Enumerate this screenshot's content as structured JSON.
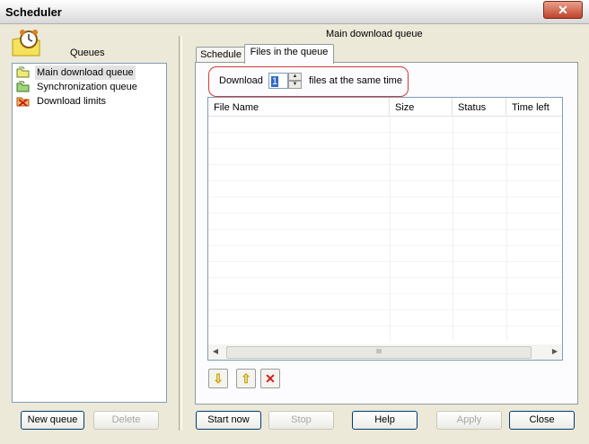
{
  "window": {
    "title": "Scheduler",
    "close_glyph": "✕"
  },
  "sidebar": {
    "heading": "Queues",
    "items": [
      {
        "label": "Main download queue",
        "icon": "queue-folder-icon",
        "selected": true
      },
      {
        "label": "Synchronization queue",
        "icon": "sync-queue-icon",
        "selected": false
      },
      {
        "label": "Download limits",
        "icon": "download-limits-icon",
        "selected": false
      }
    ],
    "new_queue_label": "New queue",
    "delete_label": "Delete"
  },
  "main": {
    "heading": "Main download queue",
    "tabs": [
      {
        "label": "Schedule",
        "active": false
      },
      {
        "label": "Files in the queue",
        "active": true
      }
    ],
    "download_prefix": "Download",
    "concurrent_value": "1",
    "download_suffix": "files at the same time",
    "table": {
      "columns": [
        "File Name",
        "Size",
        "Status",
        "Time left"
      ],
      "rows": [],
      "scroll_grip": "III"
    },
    "action_icons": [
      {
        "name": "move-down-icon",
        "glyph": "⇩",
        "color": "#c8a400"
      },
      {
        "name": "move-up-icon",
        "glyph": "⇧",
        "color": "#c8a400"
      },
      {
        "name": "remove-icon",
        "glyph": "✕",
        "color": "#d11a1a"
      }
    ]
  },
  "footer": {
    "start_now_label": "Start now",
    "stop_label": "Stop",
    "help_label": "Help",
    "apply_label": "Apply",
    "close_label": "Close"
  },
  "colors": {
    "accent_border": "#d33a3a",
    "selection": "#316ac5",
    "face": "#ece9d8"
  }
}
